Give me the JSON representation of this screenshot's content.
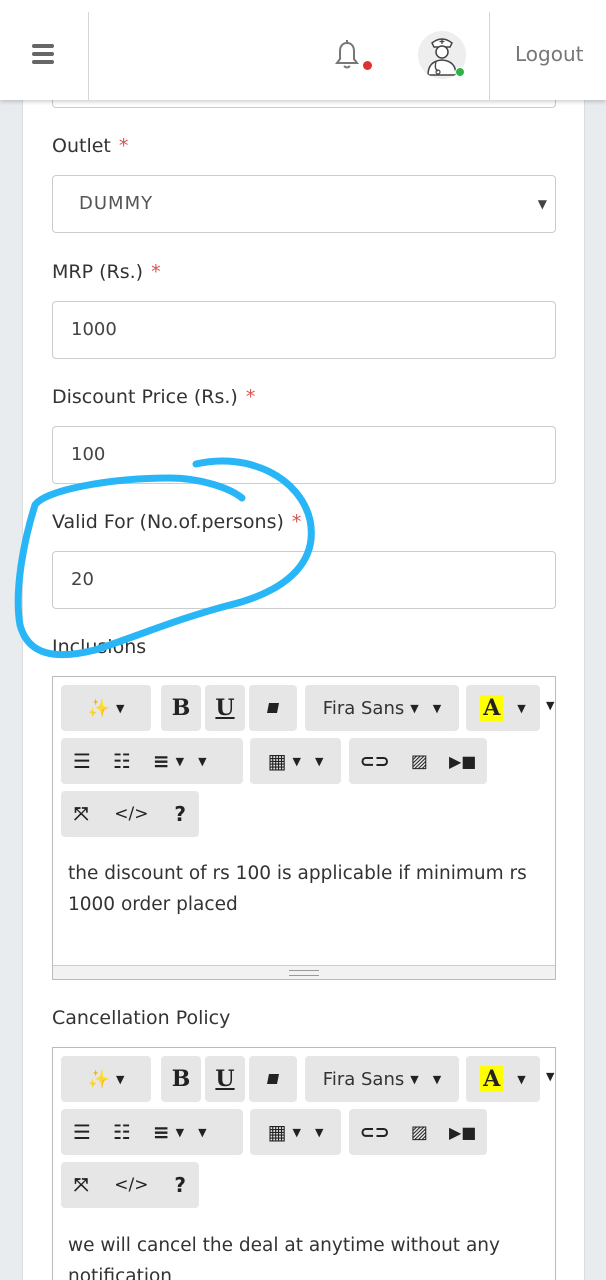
{
  "header": {
    "logout_label": "Logout",
    "icons": [
      "menu-icon",
      "bell-icon",
      "doctor-avatar-icon"
    ],
    "notification_dot_color": "#e03131",
    "online_status_color": "#2fb344"
  },
  "form": {
    "outlet": {
      "label": "Outlet",
      "required": "*",
      "value": "DUMMY"
    },
    "mrp": {
      "label": "MRP (Rs.)",
      "required": "*",
      "value": "1000"
    },
    "discount_price": {
      "label": "Discount Price (Rs.)",
      "required": "*",
      "value": "100"
    },
    "valid_for": {
      "label": "Valid For (No.of.persons)",
      "required": "*",
      "value": "20"
    },
    "inclusions": {
      "label": "Inclusions",
      "content": "the discount of rs 100 is applicable if minimum rs 1000 order placed"
    },
    "cancellation_policy": {
      "label": "Cancellation Policy",
      "content": "we will cancel the deal at anytime without any notification"
    }
  },
  "editor_toolbar": {
    "bold_label": "B",
    "underline_label": "U",
    "font_name": "Fira Sans",
    "color_label": "A",
    "code_label": "</>",
    "help_label": "?",
    "highlight_color": "#ffff00"
  },
  "annotation_color": "#29b6f6"
}
